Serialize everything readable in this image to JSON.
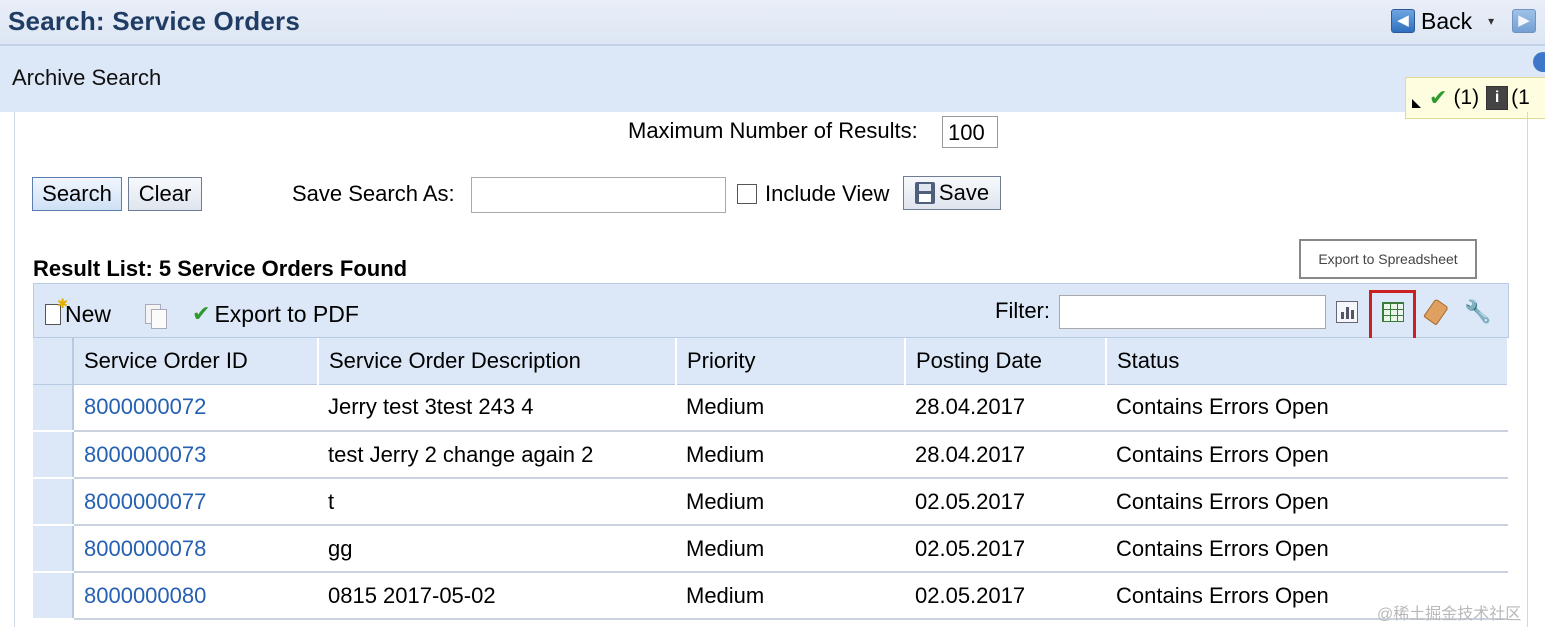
{
  "window": {
    "title": "Search: Service Orders",
    "back_label": "Back",
    "dropdown_glyph": "▾"
  },
  "archive": {
    "label": "Archive Search"
  },
  "messages": {
    "success_count": "(1)",
    "info_count": "(1"
  },
  "search_form": {
    "max_results_label": "Maximum Number of Results:",
    "max_results_value": "100",
    "search_button": "Search",
    "clear_button": "Clear",
    "save_search_as_label": "Save Search As:",
    "save_search_as_value": "",
    "include_view_label": "Include View",
    "include_view_checked": false,
    "save_button": "Save"
  },
  "result": {
    "title": "Result List: 5 Service Orders Found",
    "tooltip": "Export to Spreadsheet",
    "toolbar": {
      "new_label": "New",
      "export_pdf_label": "Export to PDF",
      "filter_label": "Filter:",
      "filter_value": "",
      "icons": [
        "chart-icon",
        "spreadsheet-icon",
        "tag-icon",
        "wrench-icon"
      ]
    },
    "columns": [
      "Service Order ID",
      "Service Order Description",
      "Priority",
      "Posting Date",
      "Status"
    ],
    "rows": [
      {
        "id": "8000000072",
        "description": "Jerry test 3test 243 4",
        "priority": "Medium",
        "date": "28.04.2017",
        "status": "Contains Errors Open"
      },
      {
        "id": "8000000073",
        "description": "test Jerry 2 change again 2",
        "priority": "Medium",
        "date": "28.04.2017",
        "status": "Contains Errors Open"
      },
      {
        "id": "8000000077",
        "description": "t",
        "priority": "Medium",
        "date": "02.05.2017",
        "status": "Contains Errors Open"
      },
      {
        "id": "8000000078",
        "description": "gg",
        "priority": "Medium",
        "date": "02.05.2017",
        "status": "Contains Errors Open"
      },
      {
        "id": "8000000080",
        "description": "0815 2017-05-02",
        "priority": "Medium",
        "date": "02.05.2017",
        "status": "Contains Errors Open"
      }
    ]
  },
  "watermark": "@稀土掘金技术社区",
  "colors": {
    "title_text": "#1f3d64",
    "band": "#dce8f7",
    "link": "#2660b2",
    "highlight": "#cc1f1f"
  }
}
